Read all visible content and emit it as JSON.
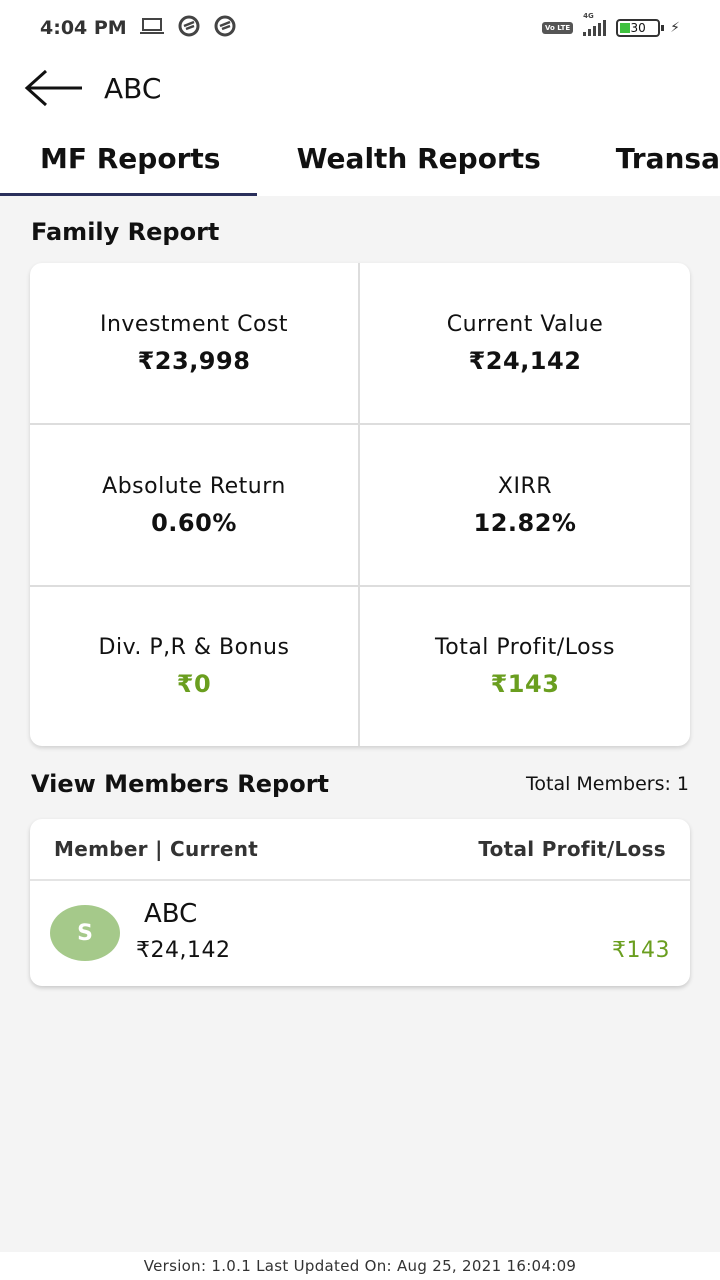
{
  "status_bar": {
    "time": "4:04 PM",
    "network": "4G",
    "volte": "Vo LTE",
    "battery": "30"
  },
  "app_bar": {
    "title": "ABC"
  },
  "tabs": [
    {
      "label": "MF Reports",
      "active": true
    },
    {
      "label": "Wealth Reports",
      "active": false
    },
    {
      "label": "Transa",
      "active": false
    }
  ],
  "family_report": {
    "title": "Family Report",
    "metrics": [
      {
        "label": "Investment Cost",
        "value": "₹23,998"
      },
      {
        "label": "Current Value",
        "value": "₹24,142"
      },
      {
        "label": "Absolute Return",
        "value": "0.60%"
      },
      {
        "label": "XIRR",
        "value": "12.82%"
      },
      {
        "label": "Div. P,R & Bonus",
        "value": "₹0"
      },
      {
        "label": "Total Profit/Loss",
        "value": "₹143"
      }
    ]
  },
  "members_report": {
    "title": "View Members Report",
    "total_members": "Total Members: 1",
    "columns": [
      "Member | Current",
      "Total Profit/Loss"
    ],
    "members": [
      {
        "initial": "S",
        "name": "ABC",
        "current": "₹24,142",
        "profit_loss": "₹143"
      }
    ]
  },
  "footer": {
    "text": "Version: 1.0.1 Last Updated On: Aug 25, 2021 16:04:09"
  },
  "colors": {
    "accent_tab": "#2a2f5b",
    "profit_green": "#6a9e1f",
    "avatar_bg": "#a5c98a"
  }
}
